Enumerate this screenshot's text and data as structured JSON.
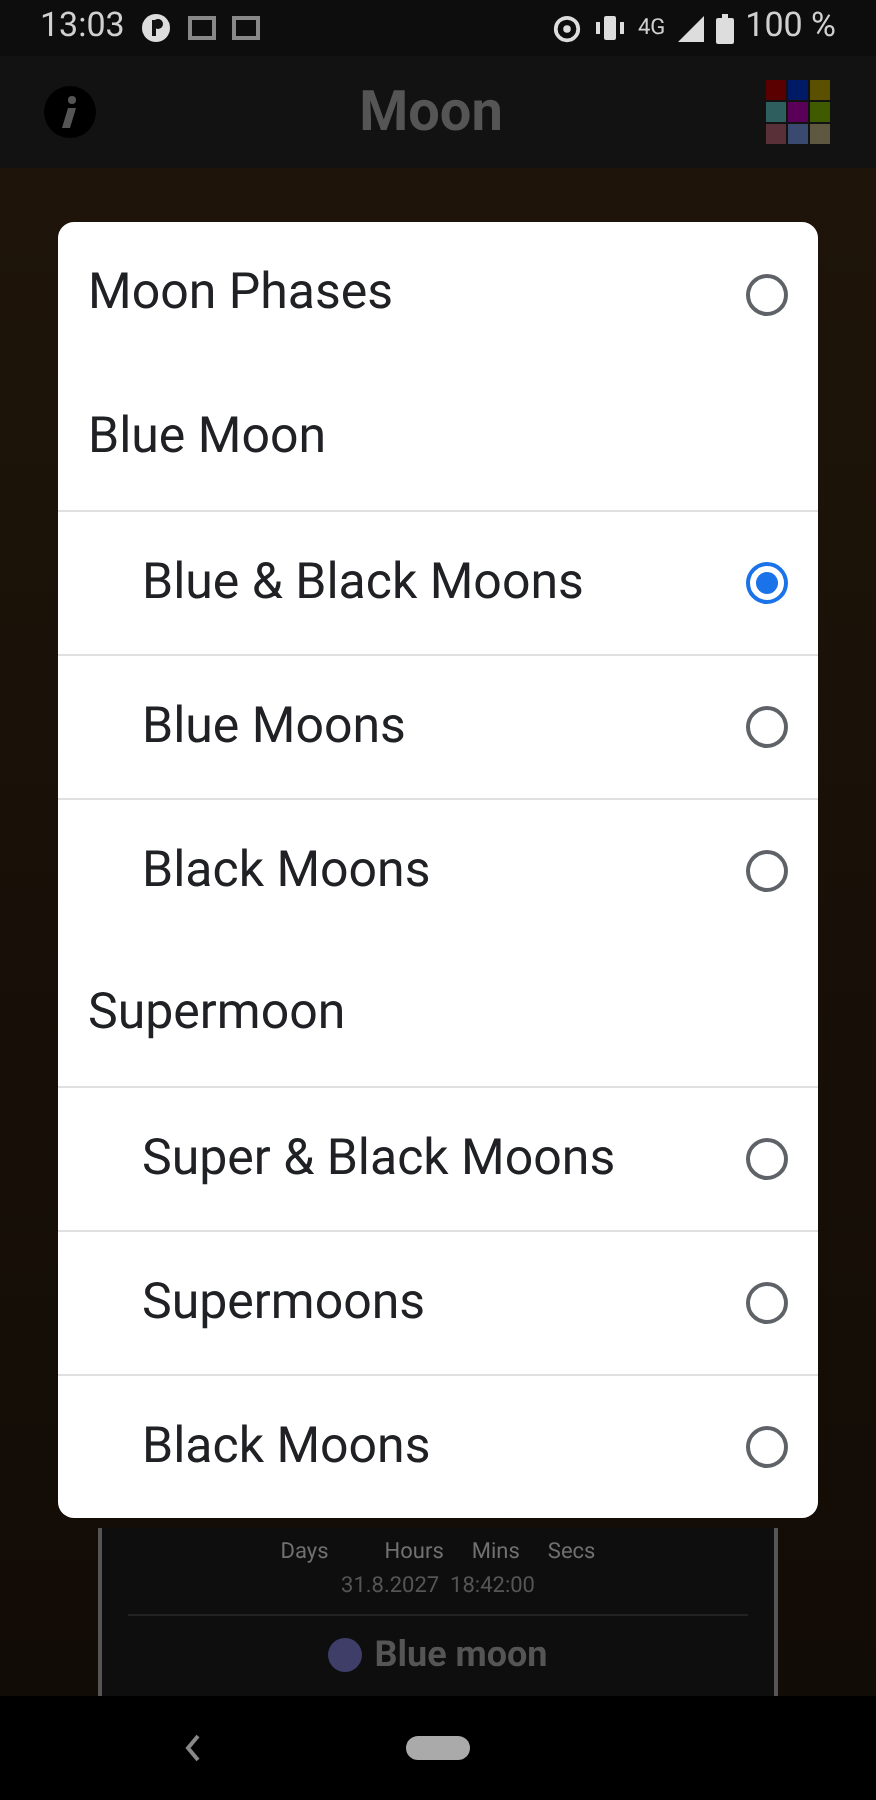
{
  "status_bar": {
    "time": "13:03",
    "network": "4G",
    "battery": "100 %"
  },
  "app_bar": {
    "title": "Moon"
  },
  "card": {
    "units": [
      "Days",
      "Hours",
      "Mins",
      "Secs"
    ],
    "date": "31.8.2027  18:42:00",
    "event": "Blue moon"
  },
  "dialog": {
    "items": [
      {
        "kind": "option",
        "label": "Moon Phases",
        "selected": false
      },
      {
        "kind": "group",
        "label": "Blue Moon",
        "children": [
          {
            "label": "Blue & Black Moons",
            "selected": true
          },
          {
            "label": "Blue Moons",
            "selected": false
          },
          {
            "label": "Black Moons",
            "selected": false
          }
        ]
      },
      {
        "kind": "group",
        "label": "Supermoon",
        "children": [
          {
            "label": "Super & Black Moons",
            "selected": false
          },
          {
            "label": "Supermoons",
            "selected": false
          },
          {
            "label": "Black Moons",
            "selected": false
          }
        ]
      }
    ]
  }
}
